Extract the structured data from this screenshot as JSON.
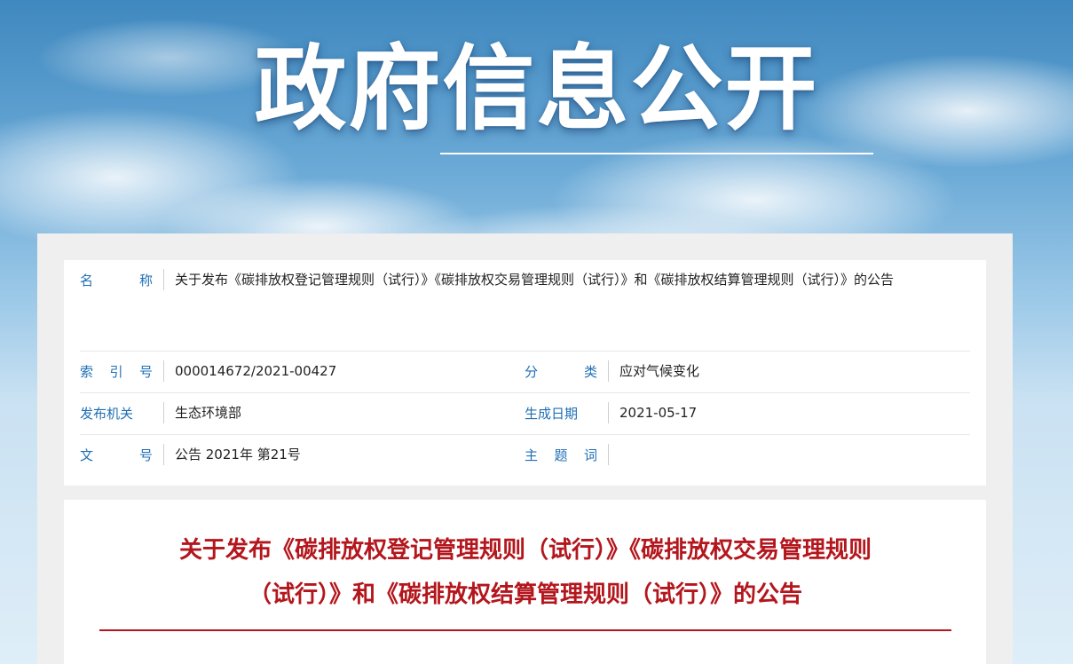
{
  "banner": {
    "title": "政府信息公开"
  },
  "meta": {
    "name_label": "名称",
    "name_value": "关于发布《碳排放权登记管理规则（试行）》《碳排放权交易管理规则（试行）》和《碳排放权结算管理规则（试行）》的公告",
    "index_label": "索引号",
    "index_value": "000014672/2021-00427",
    "category_label": "分类",
    "category_value": "应对气候变化",
    "issuer_label": "发布机关",
    "issuer_value": "生态环境部",
    "date_label": "生成日期",
    "date_value": "2021-05-17",
    "docno_label": "文号",
    "docno_value": "公告 2021年 第21号",
    "subject_label": "主题词",
    "subject_value": ""
  },
  "article": {
    "title": "关于发布《碳排放权登记管理规则（试行）》《碳排放权交易管理规则（试行）》和《碳排放权结算管理规则（试行）》的公告"
  },
  "colors": {
    "label_blue": "#1f6fb5",
    "title_red": "#b3161c"
  }
}
